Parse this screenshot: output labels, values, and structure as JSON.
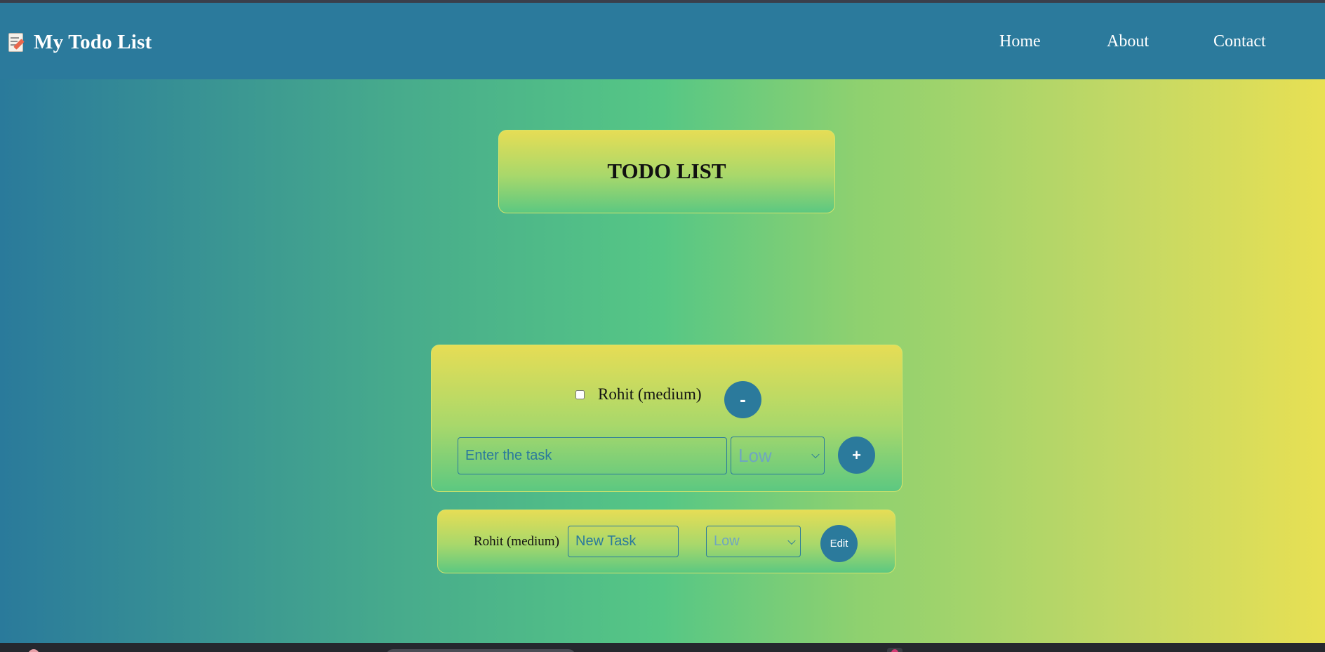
{
  "app": {
    "title": "My Todo List",
    "icon": "memo-icon"
  },
  "nav": {
    "links": [
      "Home",
      "About",
      "Contact"
    ]
  },
  "heading": "TODO LIST",
  "tasks": [
    {
      "label": "Rohit (medium)",
      "checked": false,
      "remove_label": "-"
    }
  ],
  "new_task": {
    "placeholder": "Enter the task",
    "priority_selected": "Low",
    "add_label": "+"
  },
  "edit_task": {
    "label": "Rohit (medium)",
    "placeholder": "New Task",
    "priority_selected": "Low",
    "edit_label": "Edit"
  },
  "colors": {
    "navbar": "#2b7a9c",
    "button": "#2b7a9c",
    "gradient_left": "#2a7a9b",
    "gradient_mid": "#56c785",
    "gradient_right": "#e8e053"
  }
}
